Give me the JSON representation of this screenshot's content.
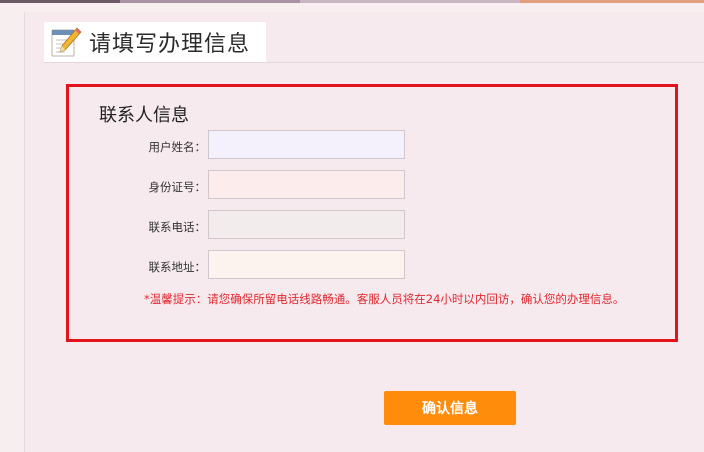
{
  "header": {
    "title": "请填写办理信息",
    "icon": "notepad-pencil-icon"
  },
  "contact_section": {
    "title": "联系人信息",
    "fields": [
      {
        "label": "用户姓名：",
        "value": "",
        "background": "#f4f0fc"
      },
      {
        "label": "身份证号：",
        "value": "",
        "background": "#fdecec"
      },
      {
        "label": "联系电话：",
        "value": "",
        "background": "#f2ecec"
      },
      {
        "label": "联系地址：",
        "value": "",
        "background": "#fdf3ee"
      }
    ],
    "notice": "*温馨提示：请您确保所留电话线路畅通。客服人员将在24小时以内回访，确认您的办理信息。"
  },
  "actions": {
    "confirm_label": "确认信息"
  },
  "colors": {
    "accent": "#ff8c0a",
    "border_red": "#e1141b",
    "notice_red": "#e0282f",
    "page_bg": "#f7eef0"
  }
}
